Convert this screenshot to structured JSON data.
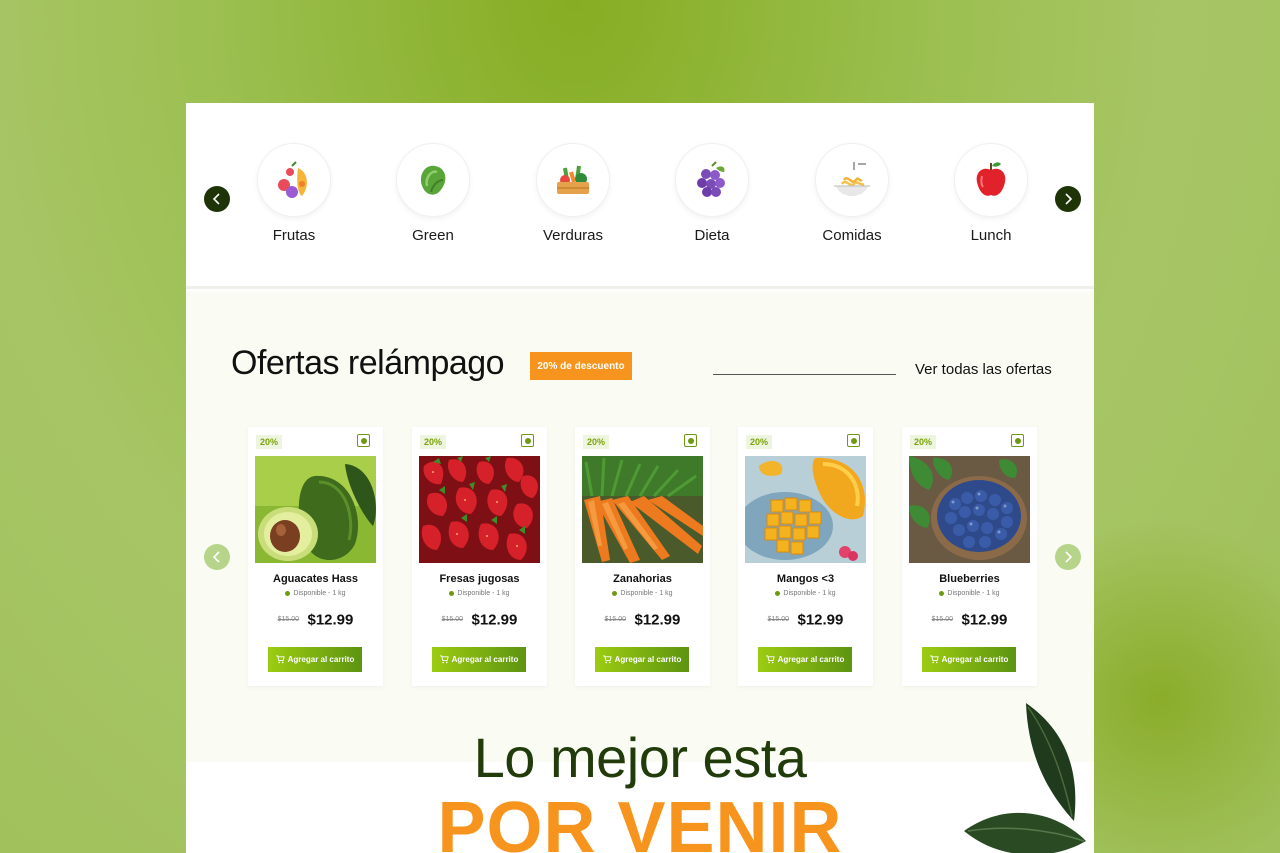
{
  "categories": [
    {
      "label": "Frutas",
      "icon": "fruits-icon"
    },
    {
      "label": "Green",
      "icon": "lettuce-icon"
    },
    {
      "label": "Verduras",
      "icon": "vegetable-basket-icon"
    },
    {
      "label": "Dieta",
      "icon": "grapes-icon"
    },
    {
      "label": "Comidas",
      "icon": "noodles-icon"
    },
    {
      "label": "Lunch",
      "icon": "apple-icon"
    }
  ],
  "offers": {
    "title": "Ofertas relámpago",
    "badge": "20% de descuento",
    "see_all": "Ver todas las ofertas"
  },
  "products": [
    {
      "name": "Aguacates Hass",
      "discount": "20%",
      "stock": "Disponible - 1 kg",
      "old_price": "$15.00",
      "price": "$12.99",
      "cta": "Agregar al carrito",
      "image": "avocado-image"
    },
    {
      "name": "Fresas jugosas",
      "discount": "20%",
      "stock": "Disponible - 1 kg",
      "old_price": "$15.00",
      "price": "$12.99",
      "cta": "Agregar al carrito",
      "image": "strawberries-image"
    },
    {
      "name": "Zanahorias",
      "discount": "20%",
      "stock": "Disponible - 1 kg",
      "old_price": "$15.00",
      "price": "$12.99",
      "cta": "Agregar al carrito",
      "image": "carrots-image"
    },
    {
      "name": "Mangos <3",
      "discount": "20%",
      "stock": "Disponible - 1 kg",
      "old_price": "$15.00",
      "price": "$12.99",
      "cta": "Agregar al carrito",
      "image": "mango-image"
    },
    {
      "name": "Blueberries",
      "discount": "20%",
      "stock": "Disponible - 1 kg",
      "old_price": "$15.00",
      "price": "$12.99",
      "cta": "Agregar al carrito",
      "image": "blueberries-image"
    }
  ],
  "hero": {
    "line1": "Lo mejor esta",
    "line2": "POR VENIR"
  },
  "colors": {
    "accent_orange": "#f7941d",
    "brand_green_dark": "#213b0a",
    "brand_green": "#7ca30a",
    "background": "#9bbf4f"
  }
}
